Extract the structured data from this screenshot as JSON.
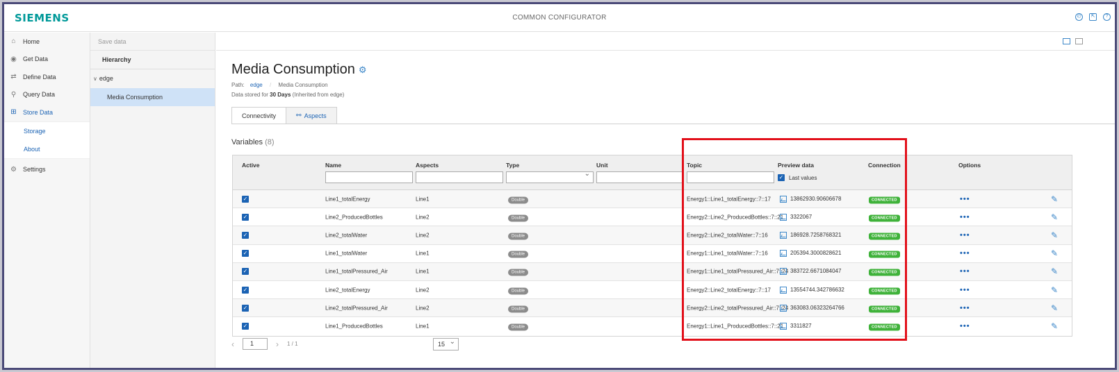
{
  "brand": {
    "logo_text": "SIEMENS",
    "color": "#009999"
  },
  "app_title": "COMMON CONFIGURATOR",
  "nav": {
    "items": [
      {
        "label": "Home",
        "icon": "home-icon"
      },
      {
        "label": "Get Data",
        "icon": "get-data-icon"
      },
      {
        "label": "Define Data",
        "icon": "define-data-icon"
      },
      {
        "label": "Query Data",
        "icon": "query-data-icon"
      },
      {
        "label": "Store Data",
        "icon": "store-data-icon",
        "active": true
      }
    ],
    "sub_items": [
      {
        "label": "Storage"
      },
      {
        "label": "About"
      }
    ],
    "settings": {
      "label": "Settings",
      "icon": "gear-icon"
    }
  },
  "hierarchy": {
    "save_data": "Save data",
    "title": "Hierarchy",
    "root": "edge",
    "selected": "Media Consumption"
  },
  "page": {
    "title": "Media Consumption",
    "path_label": "Path:",
    "path_link": "edge",
    "path_current": "Media Consumption",
    "stored_prefix": "Data stored for",
    "stored_value": "30 Days",
    "stored_suffix": "(Inherited from edge)"
  },
  "tabs": [
    {
      "label": "Connectivity",
      "active": true
    },
    {
      "label": "Aspects",
      "active": false
    }
  ],
  "variables": {
    "title": "Variables",
    "count": "(8)"
  },
  "table": {
    "headers": {
      "active": "Active",
      "name": "Name",
      "aspects": "Aspects",
      "type": "Type",
      "unit": "Unit",
      "topic": "Topic",
      "preview": "Preview data",
      "connection": "Connection",
      "options": "Options"
    },
    "last_values_label": "Last values",
    "rows": [
      {
        "name": "Line1_totalEnergy",
        "aspect": "Line1",
        "type": "Double",
        "topic": "Energy1::Line1_totalEnergy::7::17",
        "preview": "13862930.90606678",
        "connection": "CONNECTED"
      },
      {
        "name": "Line2_ProducedBottles",
        "aspect": "Line2",
        "type": "Double",
        "topic": "Energy2::Line2_ProducedBottles::7::21",
        "preview": "3322067",
        "connection": "CONNECTED"
      },
      {
        "name": "Line2_totalWater",
        "aspect": "Line2",
        "type": "Double",
        "topic": "Energy2::Line2_totalWater::7::16",
        "preview": "186928.7258768321",
        "connection": "CONNECTED"
      },
      {
        "name": "Line1_totalWater",
        "aspect": "Line1",
        "type": "Double",
        "topic": "Energy1::Line1_totalWater::7::16",
        "preview": "205394.3000828621",
        "connection": "CONNECTED"
      },
      {
        "name": "Line1_totalPressured_Air",
        "aspect": "Line1",
        "type": "Double",
        "topic": "Energy1::Line1_totalPressured_Air::7::24",
        "preview": "383722.6671084047",
        "connection": "CONNECTED"
      },
      {
        "name": "Line2_totalEnergy",
        "aspect": "Line2",
        "type": "Double",
        "topic": "Energy2::Line2_totalEnergy::7::17",
        "preview": "13554744.342786632",
        "connection": "CONNECTED"
      },
      {
        "name": "Line2_totalPressured_Air",
        "aspect": "Line2",
        "type": "Double",
        "topic": "Energy2::Line2_totalPressured_Air::7::24",
        "preview": "363083.06323264766",
        "connection": "CONNECTED"
      },
      {
        "name": "Line1_ProducedBottles",
        "aspect": "Line1",
        "type": "Double",
        "topic": "Energy1::Line1_ProducedBottles::7::21",
        "preview": "3311827",
        "connection": "CONNECTED"
      }
    ]
  },
  "pagination": {
    "page": "1",
    "total": "1 / 1",
    "per_page": "15"
  },
  "colors": {
    "accent": "#1b63b4",
    "connected": "#3fb23a",
    "highlight": "#e2101a"
  }
}
